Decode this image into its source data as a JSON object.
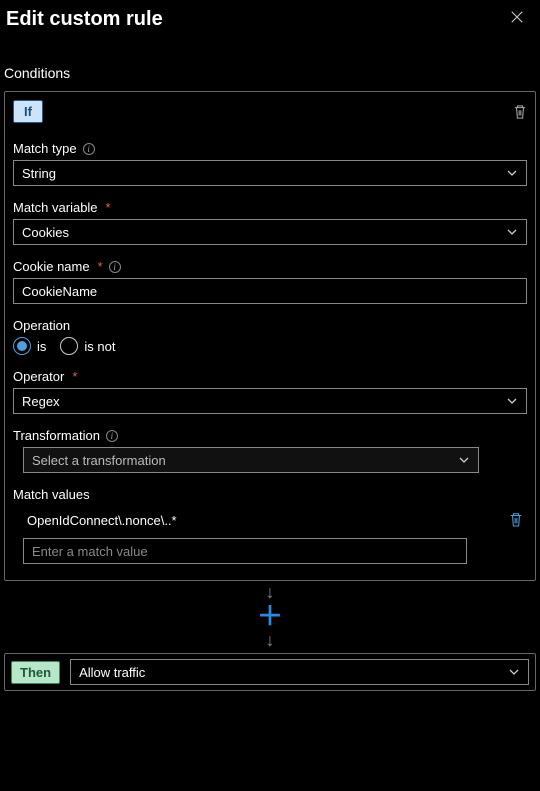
{
  "header": {
    "title": "Edit custom rule"
  },
  "sections": {
    "conditions_label": "Conditions"
  },
  "if_badge": "If",
  "fields": {
    "match_type": {
      "label": "Match type",
      "value": "String"
    },
    "match_variable": {
      "label": "Match variable",
      "value": "Cookies",
      "required": "*"
    },
    "cookie_name": {
      "label": "Cookie name",
      "value": "CookieName",
      "required": "*"
    },
    "operation": {
      "label": "Operation",
      "is_label": "is",
      "is_not_label": "is not",
      "selected": "is"
    },
    "operator": {
      "label": "Operator",
      "value": "Regex",
      "required": "*"
    },
    "transformation": {
      "label": "Transformation",
      "placeholder": "Select a transformation"
    },
    "match_values": {
      "label": "Match values",
      "items": [
        "OpenIdConnect\\.nonce\\..*"
      ],
      "input_placeholder": "Enter a match value"
    }
  },
  "then": {
    "badge": "Then",
    "action": "Allow traffic"
  }
}
